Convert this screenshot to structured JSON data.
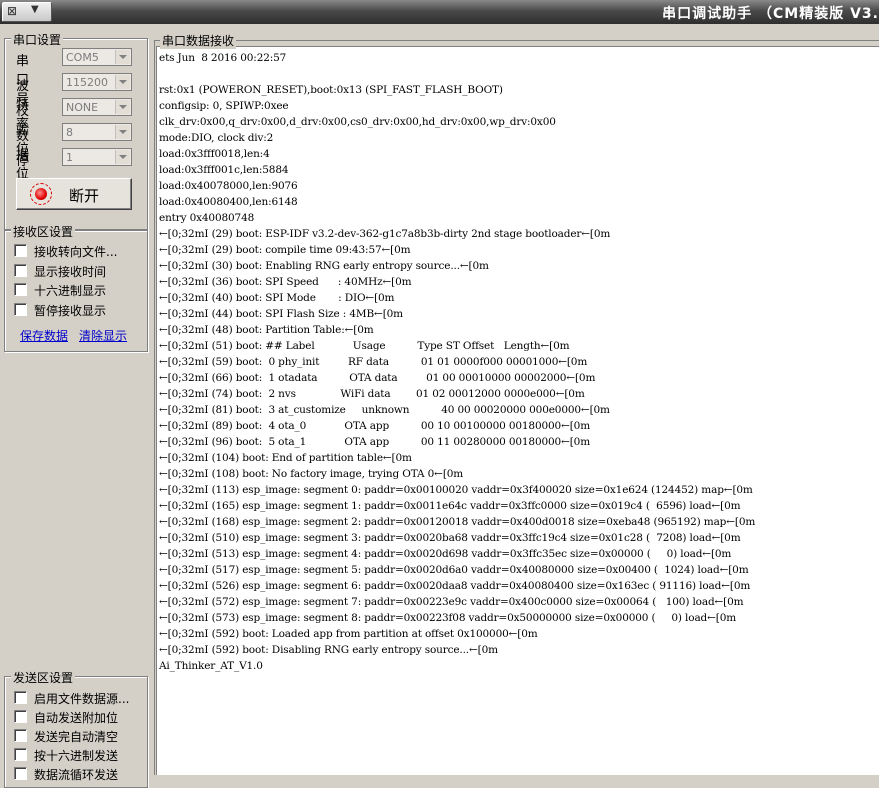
{
  "window": {
    "title": "串口调试助手 （CM精装版 V3.",
    "menu_glyph": "⊠",
    "menu_arrow": "▼"
  },
  "serial_settings": {
    "title": "串口设置",
    "fields": [
      {
        "label": "串口号",
        "value": "COM5"
      },
      {
        "label": "波特率",
        "value": "115200"
      },
      {
        "label": "校验位",
        "value": "NONE"
      },
      {
        "label": "数据位",
        "value": "8"
      },
      {
        "label": "停止位",
        "value": "1"
      }
    ],
    "connect_button": "断开"
  },
  "receive_settings": {
    "title": "接收区设置",
    "options": [
      "接收转向文件...",
      "显示接收时间",
      "十六进制显示",
      "暂停接收显示"
    ],
    "save_link": "保存数据",
    "clear_link": "清除显示"
  },
  "send_settings": {
    "title": "发送区设置",
    "options": [
      "启用文件数据源...",
      "自动发送附加位",
      "发送完自动清空",
      "按十六进制发送",
      "数据流循环发送"
    ]
  },
  "receive_area": {
    "title": "串口数据接收",
    "lines": [
      "ets Jun  8 2016 00:22:57",
      "",
      "rst:0x1 (POWERON_RESET),boot:0x13 (SPI_FAST_FLASH_BOOT)",
      "configsip: 0, SPIWP:0xee",
      "clk_drv:0x00,q_drv:0x00,d_drv:0x00,cs0_drv:0x00,hd_drv:0x00,wp_drv:0x00",
      "mode:DIO, clock div:2",
      "load:0x3fff0018,len:4",
      "load:0x3fff001c,len:5884",
      "load:0x40078000,len:9076",
      "load:0x40080400,len:6148",
      "entry 0x40080748",
      "←[0;32mI (29) boot: ESP-IDF v3.2-dev-362-g1c7a8b3b-dirty 2nd stage bootloader←[0m",
      "←[0;32mI (29) boot: compile time 09:43:57←[0m",
      "←[0;32mI (30) boot: Enabling RNG early entropy source...←[0m",
      "←[0;32mI (36) boot: SPI Speed      : 40MHz←[0m",
      "←[0;32mI (40) boot: SPI Mode       : DIO←[0m",
      "←[0;32mI (44) boot: SPI Flash Size : 4MB←[0m",
      "←[0;32mI (48) boot: Partition Table:←[0m",
      "←[0;32mI (51) boot: ## Label            Usage          Type ST Offset   Length←[0m",
      "←[0;32mI (59) boot:  0 phy_init         RF data          01 01 0000f000 00001000←[0m",
      "←[0;32mI (66) boot:  1 otadata          OTA data         01 00 00010000 00002000←[0m",
      "←[0;32mI (74) boot:  2 nvs              WiFi data        01 02 00012000 0000e000←[0m",
      "←[0;32mI (81) boot:  3 at_customize     unknown          40 00 00020000 000e0000←[0m",
      "←[0;32mI (89) boot:  4 ota_0            OTA app          00 10 00100000 00180000←[0m",
      "←[0;32mI (96) boot:  5 ota_1            OTA app          00 11 00280000 00180000←[0m",
      "←[0;32mI (104) boot: End of partition table←[0m",
      "←[0;32mI (108) boot: No factory image, trying OTA 0←[0m",
      "←[0;32mI (113) esp_image: segment 0: paddr=0x00100020 vaddr=0x3f400020 size=0x1e624 (124452) map←[0m",
      "←[0;32mI (165) esp_image: segment 1: paddr=0x0011e64c vaddr=0x3ffc0000 size=0x019c4 (  6596) load←[0m",
      "←[0;32mI (168) esp_image: segment 2: paddr=0x00120018 vaddr=0x400d0018 size=0xeba48 (965192) map←[0m",
      "←[0;32mI (510) esp_image: segment 3: paddr=0x0020ba68 vaddr=0x3ffc19c4 size=0x01c28 (  7208) load←[0m",
      "←[0;32mI (513) esp_image: segment 4: paddr=0x0020d698 vaddr=0x3ffc35ec size=0x00000 (     0) load←[0m",
      "←[0;32mI (517) esp_image: segment 5: paddr=0x0020d6a0 vaddr=0x40080000 size=0x00400 (  1024) load←[0m",
      "←[0;32mI (526) esp_image: segment 6: paddr=0x0020daa8 vaddr=0x40080400 size=0x163ec ( 91116) load←[0m",
      "←[0;32mI (572) esp_image: segment 7: paddr=0x00223e9c vaddr=0x400c0000 size=0x00064 (   100) load←[0m",
      "←[0;32mI (573) esp_image: segment 8: paddr=0x00223f08 vaddr=0x50000000 size=0x00000 (     0) load←[0m",
      "←[0;32mI (592) boot: Loaded app from partition at offset 0x100000←[0m",
      "←[0;32mI (592) boot: Disabling RNG early entropy source...←[0m",
      "Ai_Thinker_AT_V1.0"
    ]
  }
}
